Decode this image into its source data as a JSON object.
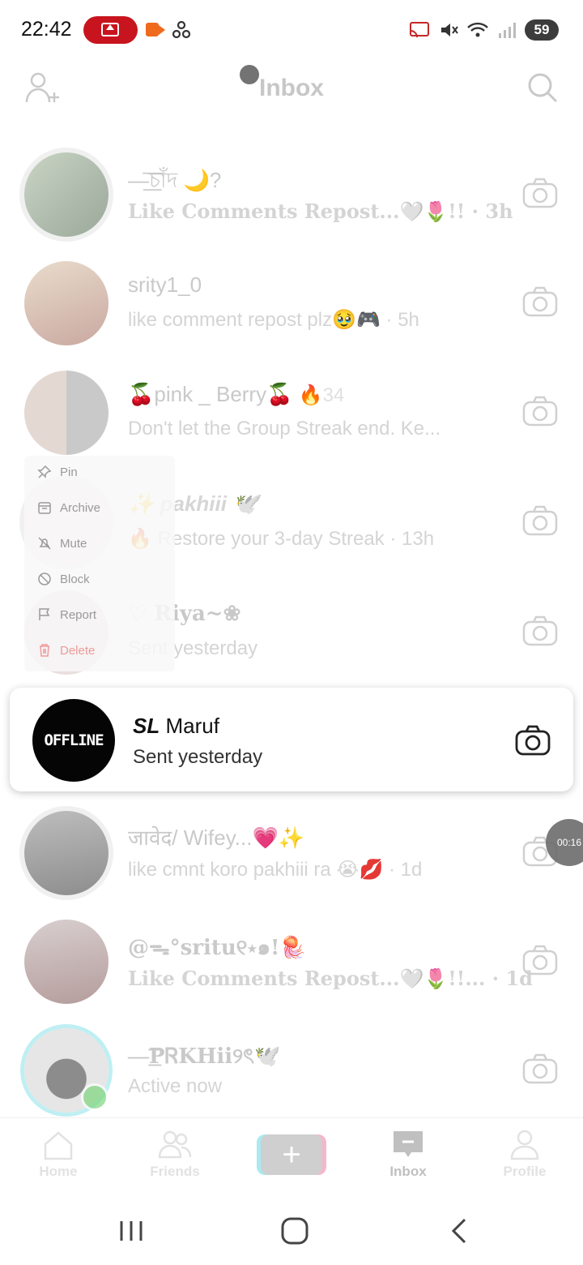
{
  "status_bar": {
    "time": "22:42",
    "battery": "59"
  },
  "header": {
    "title": "Inbox"
  },
  "chats": [
    {
      "name": "—͟͞চাঁদ 🌙?",
      "preview": "Like Comments Repost...🤍🌷!! · 3h",
      "serif": true
    },
    {
      "name": "srity1_0",
      "preview": "like comment repost plz🥹🎮 · 5h"
    },
    {
      "name": "🍒pink _ Berry🍒",
      "streak": "🔥34",
      "preview": "Don't let the Group Streak end. Ke..."
    },
    {
      "name": "✨ pakhiii 🕊️",
      "preview": "🔥 Restore your 3-day Streak · 13h"
    },
    {
      "name": "♡ Riya~❀",
      "preview": "Sent yesterday",
      "serif": true
    },
    {
      "name": "जावेद/ Wifey...💗✨",
      "preview": "like cmnt koro pakhiii ra 😭💋 · 1d"
    },
    {
      "name": "@ᯓ°sritu୧⋆๑!🪼",
      "preview": "Like Comments Repost...🤍🌷!!...    · 1d",
      "serif": true
    },
    {
      "name": "—͟͞PᏒKHii୨ৎ🕊️",
      "preview": "Active now",
      "serif": true
    }
  ],
  "focused_chat": {
    "avatar_text": "OFFLINE",
    "name_bold": "SL",
    "name_rest": "Maruf",
    "preview": "Sent yesterday"
  },
  "context_menu": {
    "pin": "Pin",
    "archive": "Archive",
    "mute": "Mute",
    "block": "Block",
    "report": "Report",
    "delete": "Delete"
  },
  "floating_timer": "00:16",
  "bottom_nav": {
    "home": "Home",
    "friends": "Friends",
    "create": "+",
    "inbox": "Inbox",
    "profile": "Profile"
  },
  "colors": {
    "danger": "#ee9a9a",
    "rec": "#c8141e",
    "online": "#7ed67e"
  }
}
